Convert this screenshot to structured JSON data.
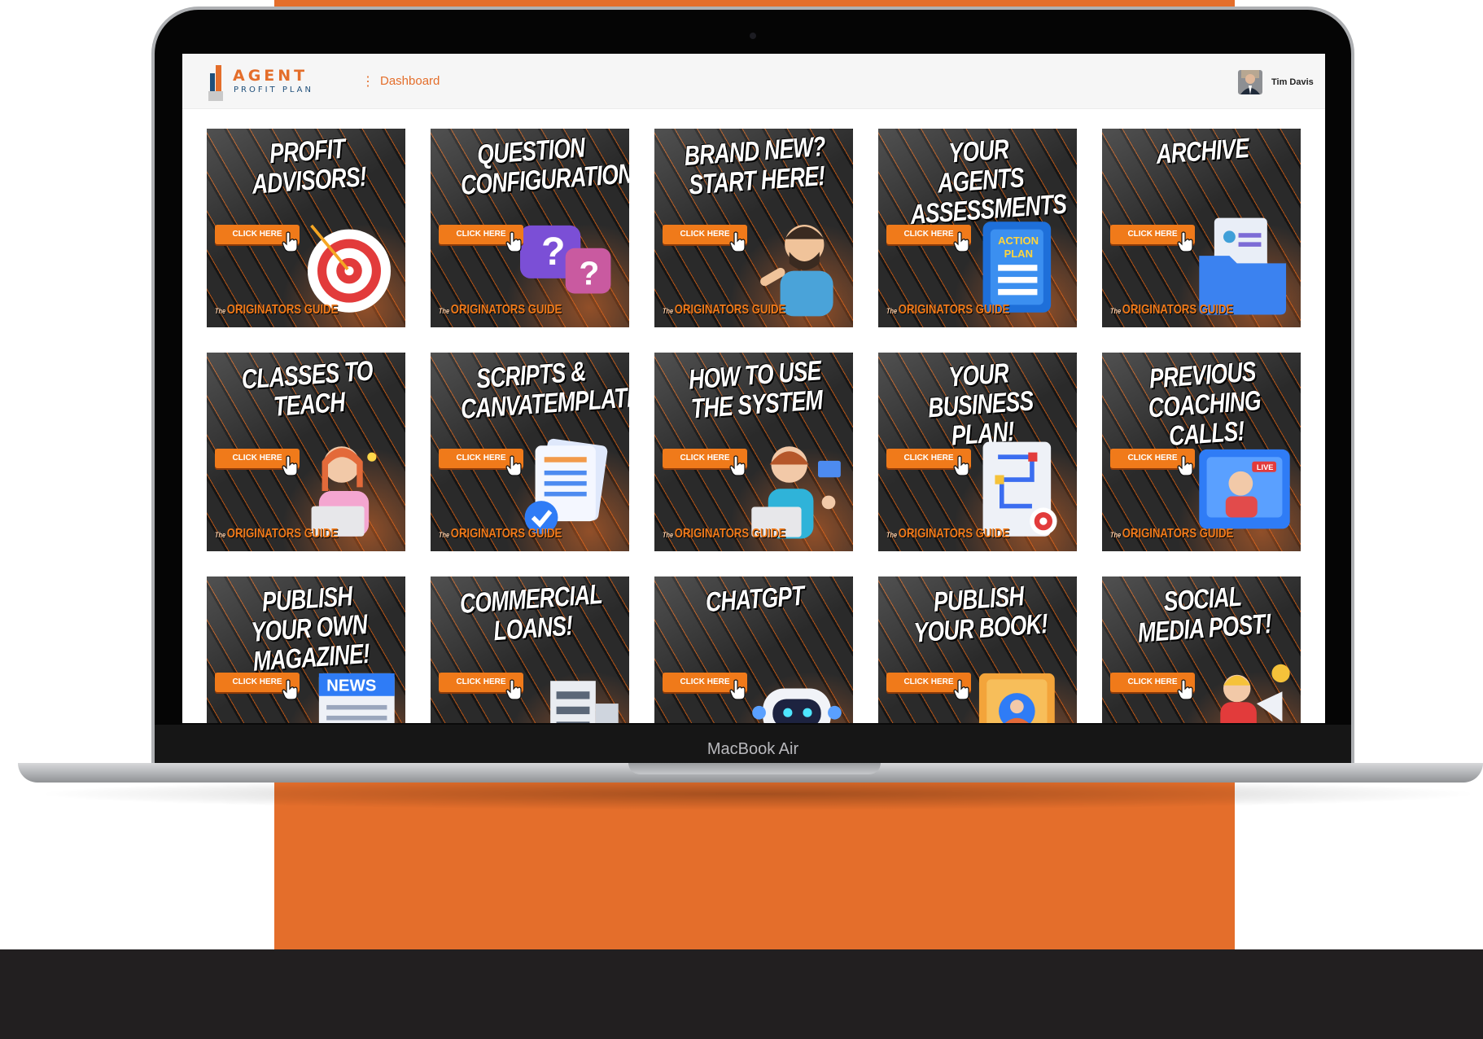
{
  "window": {
    "device_label": "MacBook Air"
  },
  "header": {
    "logo_primary": "AGENT",
    "logo_secondary": "PROFIT PLAN",
    "menu_icon": "vertical-dots-icon",
    "breadcrumb": "Dashboard",
    "user_name": "Tim Davis"
  },
  "tiles": [
    {
      "title": "PROFIT ADVISORS!",
      "button": "CLICK HERE",
      "art": "target-icon"
    },
    {
      "title": "QUESTION CONFIGURATION!",
      "button": "CLICK HERE",
      "art": "question-bubbles-icon"
    },
    {
      "title": "BRAND NEW? START HERE!",
      "button": "CLICK HERE",
      "art": "man-pointing-icon"
    },
    {
      "title": "YOUR AGENTS ASSESSMENTS",
      "button": "CLICK HERE",
      "art": "action-plan-folder-icon"
    },
    {
      "title": "ARCHIVE",
      "button": "CLICK HERE",
      "art": "archive-folder-icon"
    },
    {
      "title": "CLASSES TO TEACH",
      "button": "CLICK HERE",
      "art": "woman-laptop-icon"
    },
    {
      "title": "SCRIPTS & CANVATEMPLATES",
      "button": "CLICK HERE",
      "art": "documents-check-icon"
    },
    {
      "title": "HOW TO USE THE SYSTEM",
      "button": "CLICK HERE",
      "art": "woman-waving-icon"
    },
    {
      "title": "YOUR BUSINESS PLAN!",
      "button": "CLICK HERE",
      "art": "plan-notebook-icon"
    },
    {
      "title": "PREVIOUS COACHING CALLS!",
      "button": "CLICK HERE",
      "art": "live-video-icon"
    },
    {
      "title": "PUBLISH YOUR OWN MAGAZINE!",
      "button": "CLICK HERE",
      "art": "news-icon"
    },
    {
      "title": "COMMERCIAL LOANS!",
      "button": "CLICK HERE",
      "art": "building-icon"
    },
    {
      "title": "CHATGPT",
      "button": "CLICK HERE",
      "art": "robot-icon"
    },
    {
      "title": "PUBLISH YOUR BOOK!",
      "button": "CLICK HERE",
      "art": "book-icon"
    },
    {
      "title": "SOCIAL MEDIA POST!",
      "button": "CLICK HERE",
      "art": "megaphone-icon"
    }
  ],
  "tile_footer": {
    "prefix": "The",
    "text": "ORIGINATORS GUIDE"
  },
  "colors": {
    "accent": "#e46e2b",
    "button": "#f07a1a",
    "scene_dark": "#221f20",
    "logo_blue": "#1f4f7a"
  }
}
